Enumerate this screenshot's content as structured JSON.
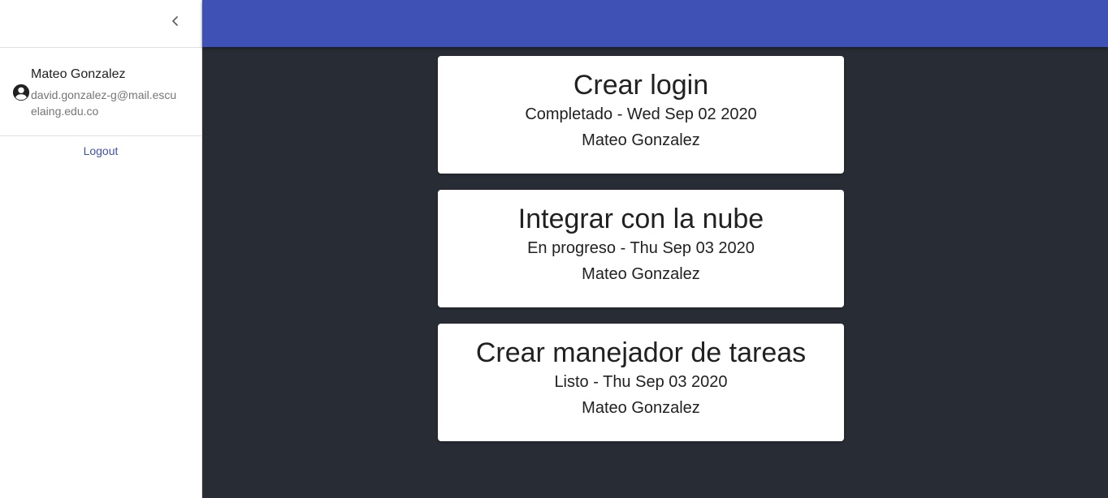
{
  "drawer": {
    "user": {
      "name": "Mateo Gonzalez",
      "email": "david.gonzalez-g@mail.escuelaing.edu.co"
    },
    "logout_label": "Logout"
  },
  "colors": {
    "appbar": "#3f51b5",
    "background": "#282c34",
    "link": "#3f51b5"
  },
  "tasks": [
    {
      "title": "Crear login",
      "status_line": "Completado - Wed Sep 02 2020",
      "owner": "Mateo Gonzalez"
    },
    {
      "title": "Integrar con la nube",
      "status_line": "En progreso - Thu Sep 03 2020",
      "owner": "Mateo Gonzalez"
    },
    {
      "title": "Crear manejador de tareas",
      "status_line": "Listo - Thu Sep 03 2020",
      "owner": "Mateo Gonzalez"
    }
  ]
}
